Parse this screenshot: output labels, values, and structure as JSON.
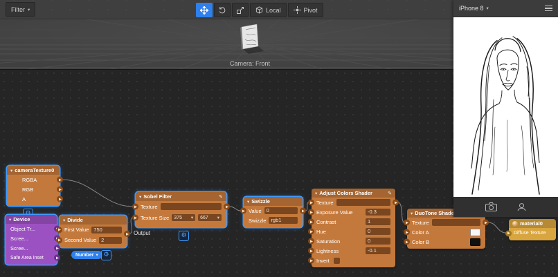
{
  "colors": {
    "accent_blue": "#2f80ec",
    "selection_blue": "#3f9bff",
    "node_orange": "#c4793c",
    "node_purple": "#9c51c2",
    "node_yellow": "#d9a53e",
    "wire_gray": "#9a9a9a"
  },
  "icons": {
    "caret_down": "▾",
    "pencil": "✎",
    "gear": "⚙"
  },
  "toolbar": {
    "filter_label": "Filter",
    "local_label": "Local",
    "pivot_label": "Pivot"
  },
  "viewport": {
    "camera_label": "Camera: Front"
  },
  "preview": {
    "device_label": "iPhone 8"
  },
  "nodes": {
    "camera_texture": {
      "title": "cameraTexture0",
      "outputs": [
        "RGBA",
        "RGB",
        "A"
      ]
    },
    "device": {
      "title": "Device",
      "outputs": [
        "Object Tr...",
        "Scree...",
        "Scree...",
        "Safe Area Inset"
      ]
    },
    "divide": {
      "title": "Divide",
      "first_label": "First Value",
      "first_value": "750",
      "second_label": "Second Value",
      "second_value": "2",
      "output_label": "Output",
      "type_badge": "Number"
    },
    "sobel": {
      "title": "Sobel Filter",
      "texture_label": "Texture",
      "size_label": "Texture Size",
      "size_x": "375",
      "size_y": "667"
    },
    "swizzle": {
      "title": "Swizzle",
      "value_label": "Value",
      "value": "0",
      "swizzle_label": "Swizzle",
      "swizzle_value": "rgb1"
    },
    "adjust": {
      "title": "Adjust Colors Shader",
      "rows": [
        {
          "label": "Texture",
          "value": null
        },
        {
          "label": "Exposure Value",
          "value": "-0.3"
        },
        {
          "label": "Contrast",
          "value": "1"
        },
        {
          "label": "Hue",
          "value": "0"
        },
        {
          "label": "Saturation",
          "value": "0"
        },
        {
          "label": "Lightness",
          "value": "-0.1"
        },
        {
          "label": "Invert",
          "value": null
        }
      ]
    },
    "duotone": {
      "title": "DuoTone Shader",
      "texture_label": "Texture",
      "color_a_label": "Color A",
      "color_b_label": "Color B",
      "color_a": "#f7f7f7",
      "color_b": "#101010"
    },
    "material": {
      "title": "material0",
      "input_label": "Diffuse Texture"
    }
  }
}
